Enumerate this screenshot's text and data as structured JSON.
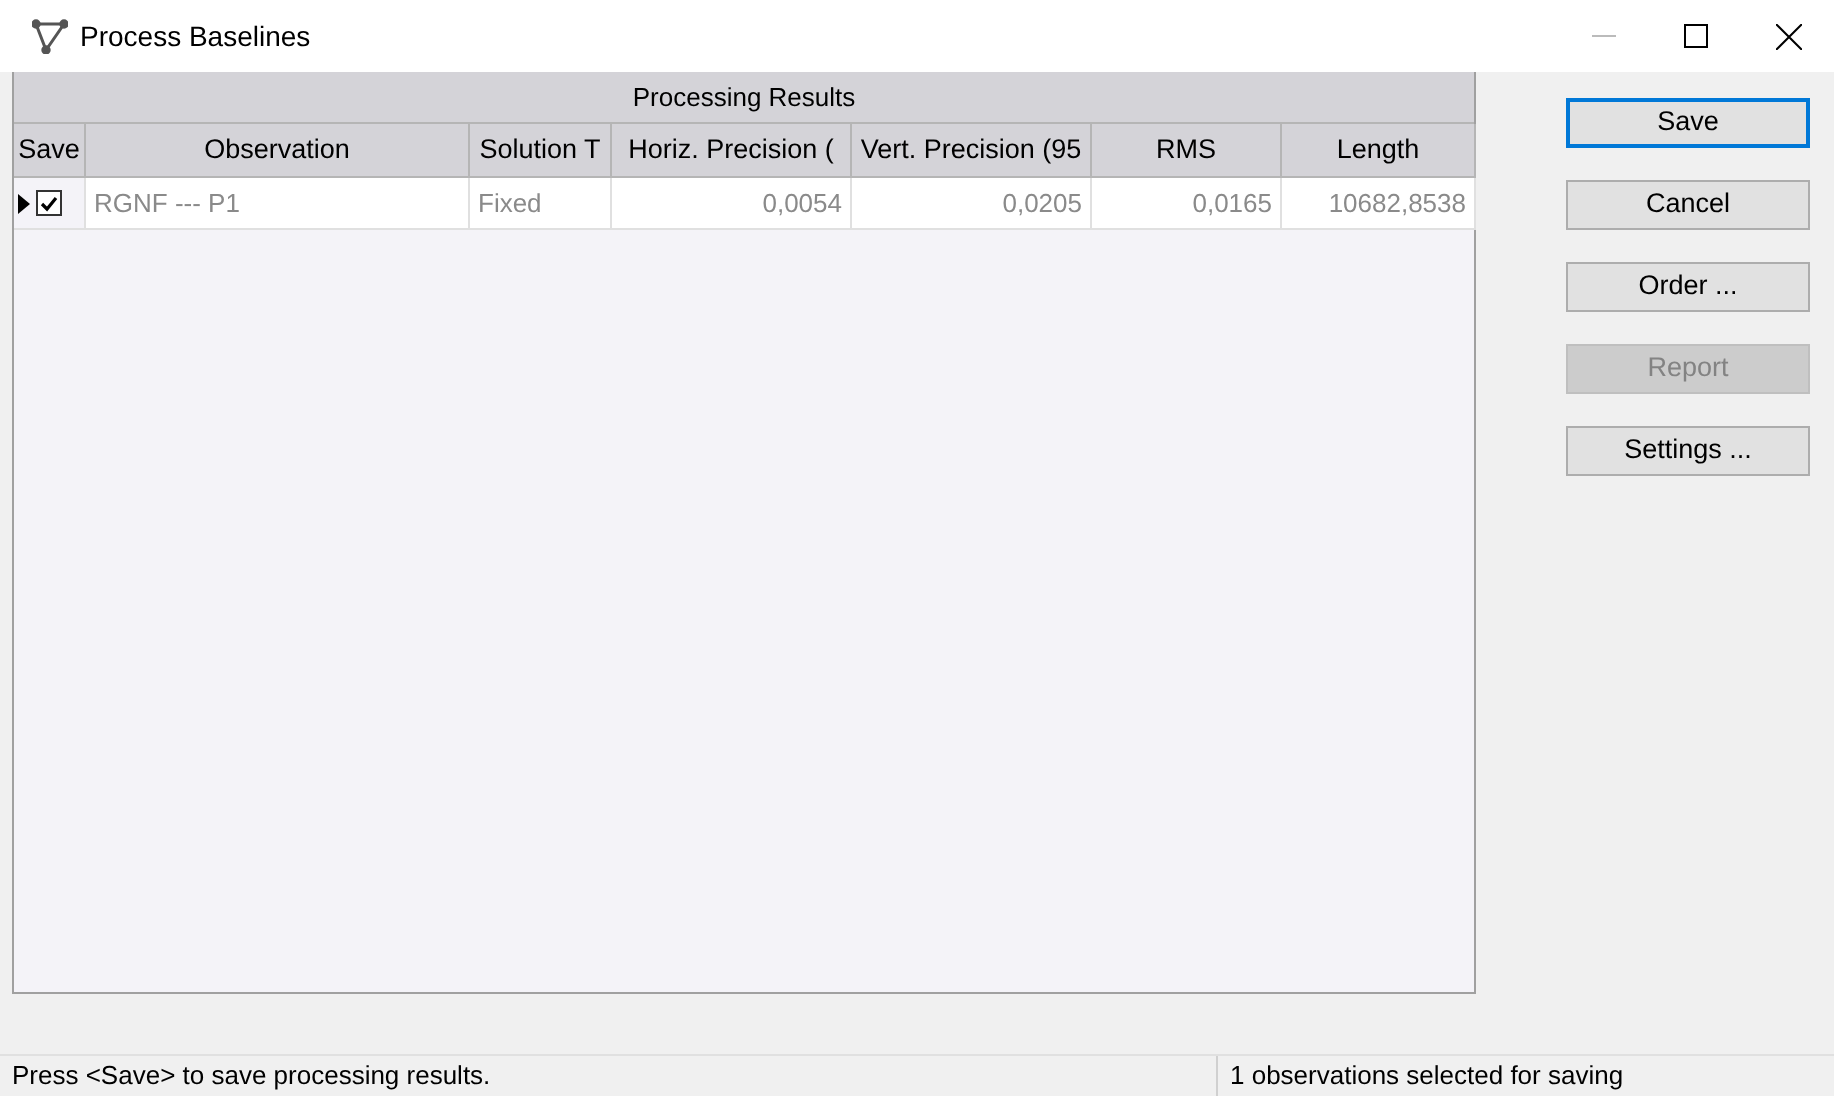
{
  "window": {
    "title": "Process Baselines"
  },
  "grid": {
    "group_header": "Processing Results",
    "columns": [
      "Save",
      "Observation",
      "Solution T",
      "Horiz. Precision (",
      "Vert. Precision (95",
      "RMS",
      "Length"
    ],
    "rows": [
      {
        "current": true,
        "checked": true,
        "cells": [
          "",
          "RGNF --- P1",
          "Fixed",
          "0,0054",
          "0,0205",
          "0,0165",
          "10682,8538"
        ]
      }
    ]
  },
  "buttons": [
    {
      "label": "Save",
      "default": true,
      "disabled": false
    },
    {
      "label": "Cancel",
      "default": false,
      "disabled": false
    },
    {
      "label": "Order ...",
      "default": false,
      "disabled": false
    },
    {
      "label": "Report",
      "default": false,
      "disabled": true
    },
    {
      "label": "Settings ...",
      "default": false,
      "disabled": false
    }
  ],
  "status_bar": [
    "Press <Save> to save processing results.",
    "1 observations selected for saving"
  ]
}
